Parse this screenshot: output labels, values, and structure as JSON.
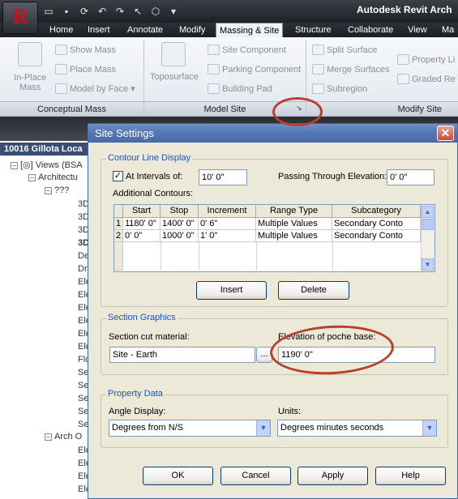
{
  "app": {
    "title": "Autodesk Revit Arch",
    "logo": "R"
  },
  "quick_access": [
    "open-icon",
    "save-icon",
    "sync-icon",
    "undo-icon",
    "redo-icon",
    "select-icon",
    "model-icon",
    "dropdown-icon"
  ],
  "ribbon": {
    "tabs": [
      "Home",
      "Insert",
      "Annotate",
      "Modify",
      "Massing & Site",
      "Structure",
      "Collaborate",
      "View",
      "Ma"
    ],
    "active_tab": "Massing & Site",
    "conceptual_mass": {
      "label": "Conceptual Mass",
      "in_place_line1": "In-Place",
      "in_place_line2": "Mass",
      "show_mass": "Show Mass",
      "place_mass": "Place Mass",
      "model_by_face": "Model by Face"
    },
    "model_site": {
      "label": "Model Site",
      "toposurface": "Toposurface",
      "site_component": "Site Component",
      "parking_component": "Parking Component",
      "building_pad": "Building Pad"
    },
    "modify_site": {
      "label": "Modify Site",
      "split_surface": "Split Surface",
      "merge_surfaces": "Merge Surfaces",
      "subregion": "Subregion",
      "property_lines": "Property Li",
      "graded_region": "Graded Re"
    },
    "launcher_glyph": "↘"
  },
  "browser": {
    "header": "10016 Gillota Loca",
    "items": [
      "Views (BSA",
      "Architectu",
      "???",
      "3D",
      "3D",
      "3D",
      "3D",
      "De",
      "Dr",
      "Ele",
      "Ele",
      "Ele",
      "Ele",
      "Ele",
      "Ele",
      "Flo",
      "Se",
      "Se",
      "Se",
      "Se",
      "Se",
      "Arch O",
      "Ele",
      "Ele",
      "Ele",
      "Ele"
    ]
  },
  "dialog": {
    "title": "Site Settings",
    "close_glyph": "✕",
    "contour": {
      "group_label": "Contour Line Display",
      "at_intervals_label": "At Intervals of:",
      "at_intervals_checked": "✓",
      "interval_value": "10'  0\"",
      "passing_label": "Passing Through Elevation:",
      "passing_value": "0'  0\"",
      "additional_label": "Additional Contours:",
      "columns": [
        "Start",
        "Stop",
        "Increment",
        "Range Type",
        "Subcategory"
      ],
      "rows": [
        {
          "num": "1",
          "start": "1180'  0\"",
          "stop": "1400'  0\"",
          "increment": "0'  6\"",
          "range_type": "Multiple Values",
          "subcategory": "Secondary Conto"
        },
        {
          "num": "2",
          "start": "0'  0\"",
          "stop": "1000'  0\"",
          "increment": "1'  0\"",
          "range_type": "Multiple Values",
          "subcategory": "Secondary Conto"
        }
      ],
      "insert_label": "Insert",
      "delete_label": "Delete"
    },
    "section": {
      "group_label": "Section Graphics",
      "cut_material_label": "Section cut material:",
      "cut_material_value": "Site - Earth",
      "browse_label": "...",
      "poche_label": "Elevation of poche base:",
      "poche_value": "1190'  0\""
    },
    "property": {
      "group_label": "Property Data",
      "angle_label": "Angle Display:",
      "angle_value": "Degrees from N/S",
      "units_label": "Units:",
      "units_value": "Degrees minutes seconds"
    },
    "buttons": {
      "ok": "OK",
      "cancel": "Cancel",
      "apply": "Apply",
      "help": "Help"
    }
  },
  "colors": {
    "annotation": "#b7412a",
    "dialog_title": "#5578b5",
    "group_title": "#1d53c0"
  }
}
